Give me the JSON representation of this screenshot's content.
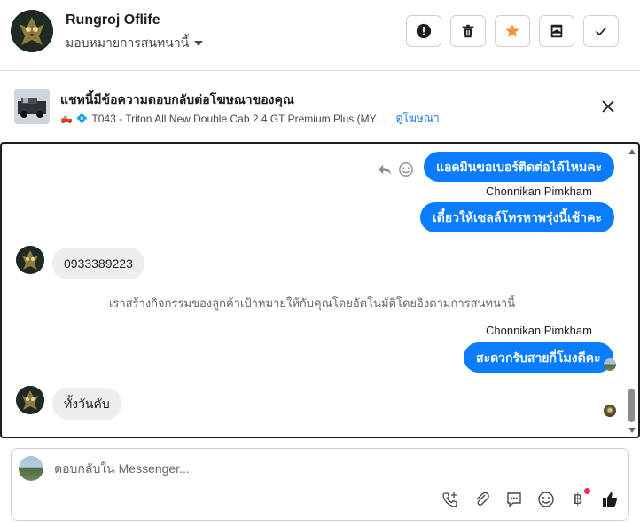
{
  "header": {
    "user_name": "Rungroj Oflife",
    "assign_label": "มอบหมายการสนทนานี้",
    "buttons": [
      {
        "name": "spam-button",
        "icon": "alert-icon"
      },
      {
        "name": "delete-button",
        "icon": "trash-icon"
      },
      {
        "name": "star-button",
        "icon": "star-icon",
        "color": "#f7923b"
      },
      {
        "name": "move-inbox-button",
        "icon": "inbox-icon"
      },
      {
        "name": "mark-done-button",
        "icon": "check-icon"
      }
    ]
  },
  "ad_banner": {
    "title": "แชทนี้มีข้อความตอบกลับต่อโฆษณาของคุณ",
    "subtitle": "T043 - Triton All New Double Cab 2.4 GT Premium Plus (MY…",
    "link": "ดูโฆษณา"
  },
  "chat": {
    "messages": [
      {
        "type": "outgoing",
        "text": "แอดมินขอเบอร์ติดต่อได้ไหมคะ"
      },
      {
        "type": "sender",
        "text": "Chonnikan Pimkham"
      },
      {
        "type": "outgoing",
        "text": "เดี๋ยวให้เซลล์โทรหาพรุ่งนี้เช้าคะ"
      },
      {
        "type": "incoming",
        "text": "0933389223"
      },
      {
        "type": "system",
        "text": "เราสร้างกิจกรรมของลูกค้าเป้าหมายให้กับคุณโดยอัตโนมัติโดยอิงตามการสนทนานี้"
      },
      {
        "type": "sender",
        "text": "Chonnikan Pimkham"
      },
      {
        "type": "outgoing",
        "text": "สะดวกรับสายกี่โมงดีคะ"
      },
      {
        "type": "incoming",
        "text": "ทั้งวันคับ"
      }
    ]
  },
  "composer": {
    "placeholder": "ตอบกลับใน Messenger...",
    "tools": [
      "call-add-icon",
      "attachment-icon",
      "saved-reply-icon",
      "emoji-icon",
      "baht-payment-icon",
      "like-icon"
    ],
    "baht_symbol": "฿",
    "accent": "#0a7cff"
  },
  "colors": {
    "outgoing_bubble": "#0a7cff",
    "incoming_bubble": "#eceef1",
    "link": "#1877f2",
    "notification_dot": "#f02849"
  }
}
